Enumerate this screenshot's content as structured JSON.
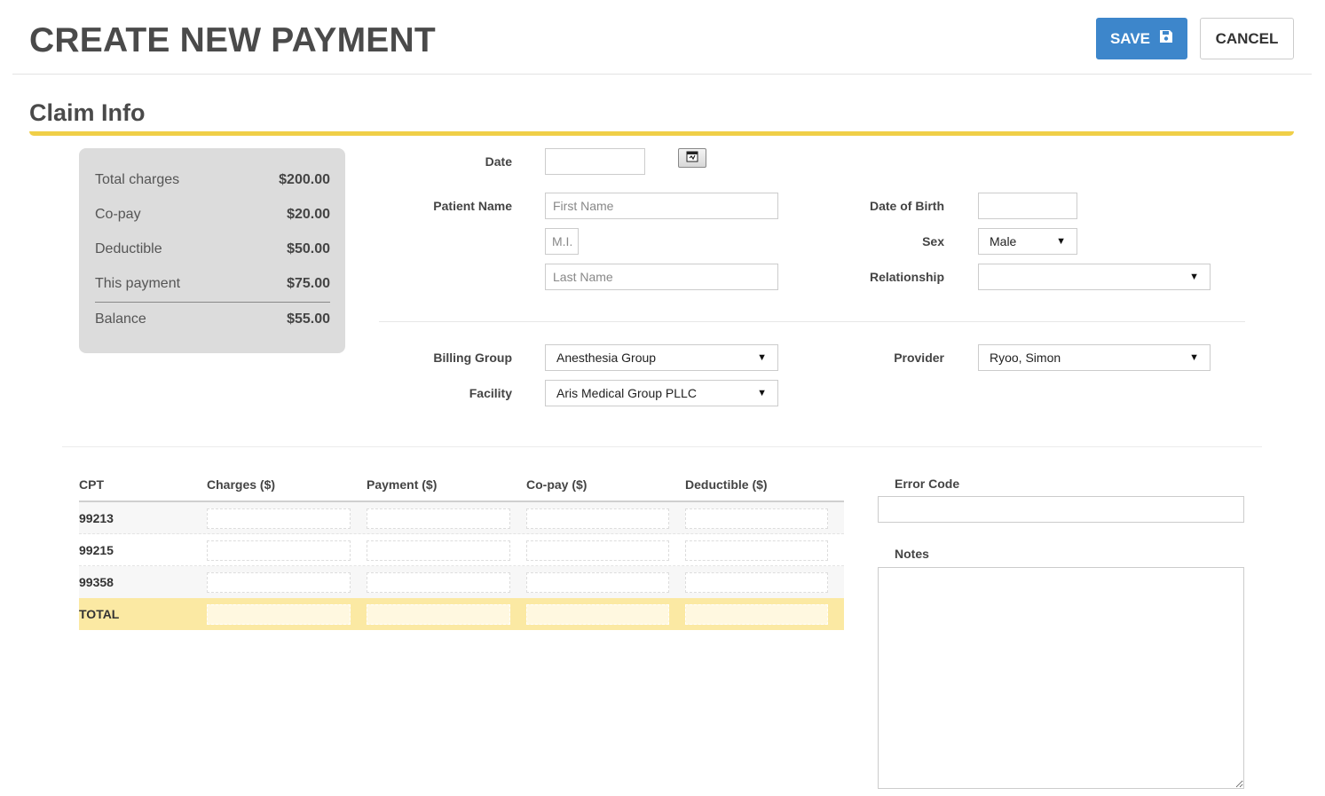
{
  "header": {
    "title": "CREATE NEW PAYMENT",
    "save_label": "SAVE",
    "cancel_label": "CANCEL"
  },
  "section": {
    "title": "Claim Info"
  },
  "summary": {
    "rows": [
      {
        "label": "Total charges",
        "value": "$200.00"
      },
      {
        "label": "Co-pay",
        "value": "$20.00"
      },
      {
        "label": "Deductible",
        "value": "$50.00"
      },
      {
        "label": "This payment",
        "value": "$75.00"
      },
      {
        "label": "Balance",
        "value": "$55.00"
      }
    ]
  },
  "form": {
    "date_label": "Date",
    "date_value": "",
    "patient_name_label": "Patient Name",
    "first_name_placeholder": "First Name",
    "mi_placeholder": "M.I.",
    "last_name_placeholder": "Last Name",
    "dob_label": "Date of Birth",
    "dob_value": "",
    "sex_label": "Sex",
    "sex_value": "Male",
    "relationship_label": "Relationship",
    "relationship_value": "",
    "billing_group_label": "Billing Group",
    "billing_group_value": "Anesthesia Group",
    "facility_label": "Facility",
    "facility_value": "Aris Medical Group PLLC",
    "provider_label": "Provider",
    "provider_value": "Ryoo, Simon"
  },
  "table": {
    "columns": [
      "CPT",
      "Charges ($)",
      "Payment ($)",
      "Co-pay ($)",
      "Deductible ($)"
    ],
    "rows": [
      {
        "cpt": "99213"
      },
      {
        "cpt": "99215"
      },
      {
        "cpt": "99358"
      }
    ],
    "total_label": "TOTAL"
  },
  "side": {
    "error_code_label": "Error Code",
    "error_code_value": "",
    "notes_label": "Notes",
    "notes_value": ""
  },
  "icons": {
    "save": "floppy-disk-icon",
    "calendar": "calendar-icon",
    "dropdown": "caret-down-icon"
  }
}
